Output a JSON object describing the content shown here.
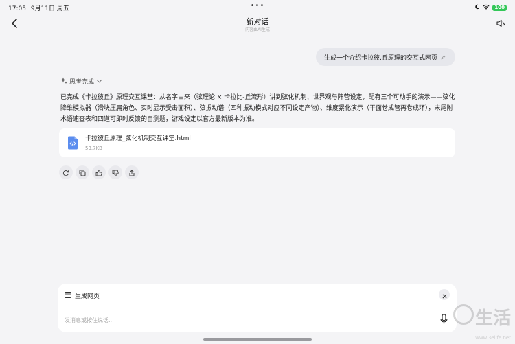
{
  "status_bar": {
    "time": "17:05",
    "date": "9月11日 周五",
    "battery": "100"
  },
  "header": {
    "title": "新对话",
    "subtitle": "内容由AI生成"
  },
  "user_message": "生成一个介绍卡拉彼.丘原理的交互式网页",
  "thinking_label": "思考完成",
  "response_text": "已完成《卡拉彼丘》原理交互课堂：从名字由来（弦理论 × 卡拉比-丘流形）讲到弦化机制、世界观与阵营设定，配有三个可动手的演示——弦化降维模拟器（滑块压扁角色、实时显示受击面积）、弦振动谱（四种振动模式对应不同设定产物）、维度紧化演示（平面卷成管再卷成环），末尾附术语速查表和四道可即时反馈的自测题，游戏设定以官方最新版本为准。",
  "file": {
    "name": "卡拉彼丘原理_弦化机制交互课堂.html",
    "size": "53.7KB"
  },
  "composer": {
    "tag_label": "生成网页",
    "placeholder": "发消息或按住说话..."
  },
  "watermark": {
    "text": "生活",
    "url": "www.3elife.net"
  },
  "colors": {
    "background": "#f4f4f6",
    "bubble": "#e6e7ec",
    "file_icon": "#5b8def",
    "battery": "#34c759"
  },
  "icons": [
    "chevron-left-icon",
    "speaker-icon",
    "sparkle-icon",
    "chevron-down-icon",
    "edit-icon",
    "code-file-icon",
    "refresh-icon",
    "copy-icon",
    "thumbs-up-icon",
    "thumbs-down-icon",
    "share-icon",
    "webpage-icon",
    "close-icon",
    "mic-icon"
  ]
}
